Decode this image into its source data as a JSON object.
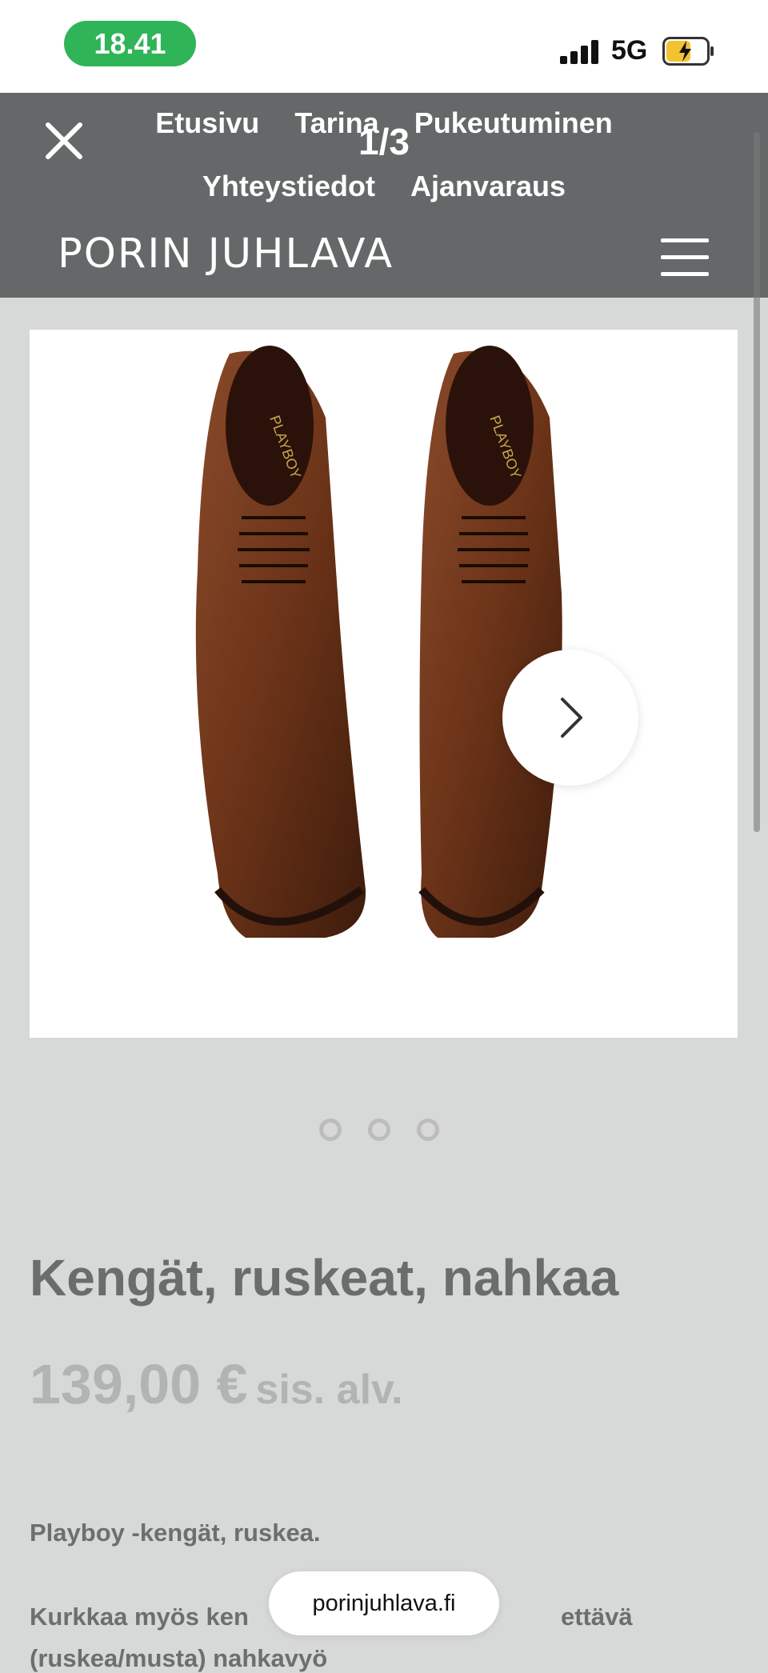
{
  "status_bar": {
    "time": "18.41",
    "network": "5G",
    "time_pill_color": "#2fb457"
  },
  "overlay": {
    "nav_items": [
      "Etusivu",
      "Tarina",
      "Pukeutuminen",
      "Yhteystiedot",
      "Ajanvaraus"
    ],
    "counter": "1/3",
    "logo": "PORIN JUHLAVA",
    "header_color": "#646868"
  },
  "gallery": {
    "current_image": 1,
    "total_images": 3,
    "image_subject": "brown leather lace-up shoes"
  },
  "product": {
    "title": "Kengät, ruskeat, nahkaa",
    "price": "139,00 €",
    "vat_note": "sis. alv.",
    "desc_line1": "Playboy -kengät, ruskea.",
    "desc_line2": "Kurkkaa myös ken",
    "desc_line2_end": "ettävä",
    "desc_line3": "(ruskea/musta) nahkavyö"
  },
  "browser": {
    "url": "porinjuhlava.fi"
  },
  "icons": {
    "close": "close-icon",
    "menu": "hamburger-menu-icon",
    "next": "chevron-right-icon",
    "battery": "battery-charging-icon",
    "signal": "signal-icon"
  }
}
